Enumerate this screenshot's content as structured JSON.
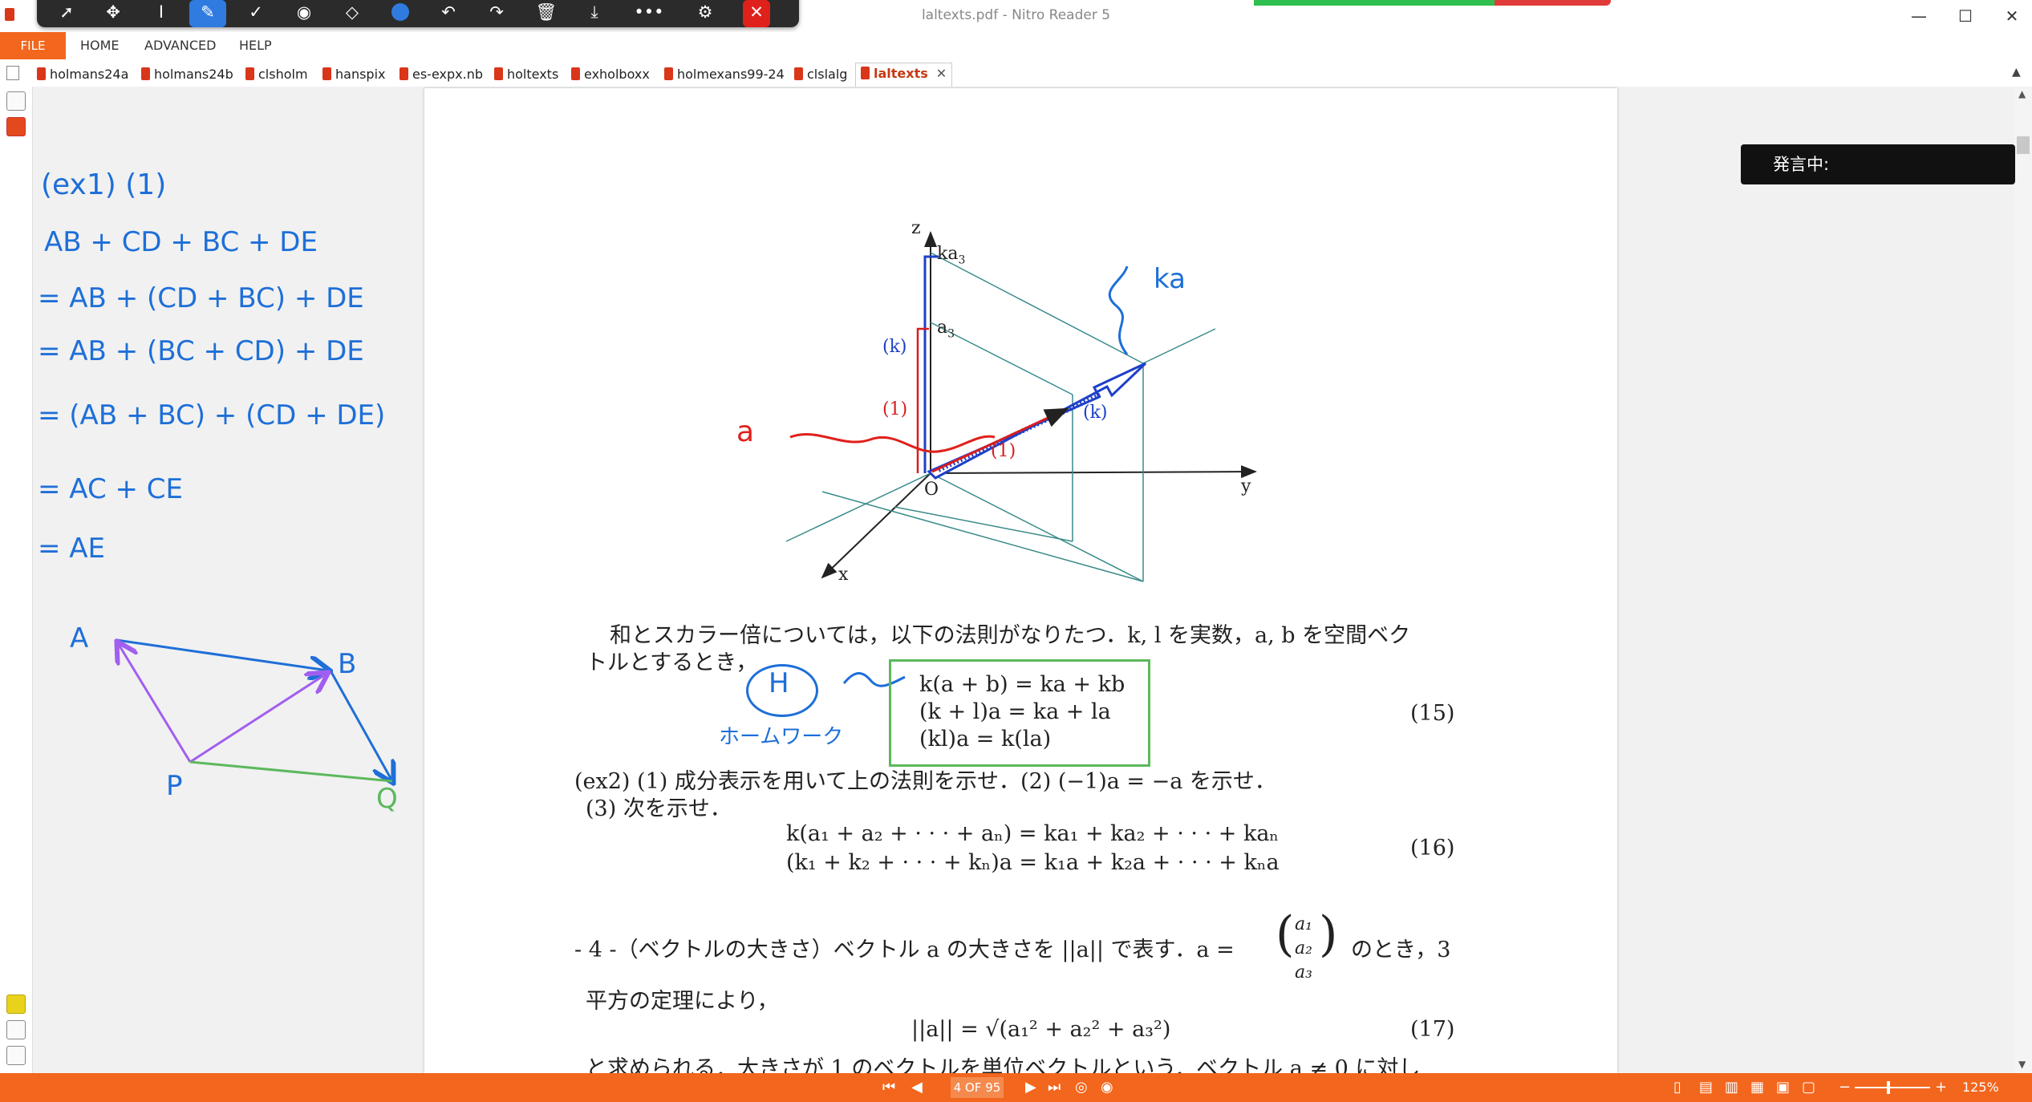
{
  "window": {
    "title": "laltexts.pdf - Nitro Reader 5",
    "minimize": "—",
    "maximize": "☐",
    "close": "✕"
  },
  "ribbon": {
    "file": "FILE",
    "home": "HOME",
    "advanced": "ADVANCED",
    "help": "HELP"
  },
  "tabs": [
    {
      "label": "holmans24a"
    },
    {
      "label": "holmans24b"
    },
    {
      "label": "clsholm"
    },
    {
      "label": "hanspix"
    },
    {
      "label": "es-expx.nb"
    },
    {
      "label": "holtexts"
    },
    {
      "label": "exholboxx"
    },
    {
      "label": "holmexans99-24"
    },
    {
      "label": "clslalg"
    },
    {
      "label": "laltexts"
    }
  ],
  "speaking_overlay": "発言中:",
  "status": {
    "page": "4 OF 95",
    "zoom": "125%"
  },
  "figure": {
    "z": "z",
    "y": "y",
    "x": "x",
    "origin": "O",
    "ka3": "ka",
    "ka3_sub": "3",
    "a3": "a",
    "a3_sub": "3",
    "k_left": "(k)",
    "one_left": "(1)",
    "k_arrow": "(k)",
    "one_arrow": "(1)"
  },
  "document": {
    "para1_line1": "和とスカラー倍については，以下の法則がなりたつ．k, l を実数，a, b を空間ベク",
    "para1_line2": "トルとするとき，",
    "eq15": [
      "k(a + b) = ka + kb",
      "(k + l)a = ka + la",
      "(kl)a = k(la)"
    ],
    "eq15_num": "(15)",
    "ex2_line1": "(ex2) (1) 成分表示を用いて上の法則を示せ．(2) (−1)a = −a を示せ．",
    "ex2_line2": "(3) 次を示せ．",
    "eq16": [
      "k(a₁ + a₂ + · · · + aₙ) = ka₁ + ka₂ + · · · + kaₙ",
      "(k₁ + k₂ + · · · + kₙ)a = k₁a + k₂a + · · · + kₙa"
    ],
    "eq16_num": "(16)",
    "sec4_pre": "- 4 -（ベクトルの大きさ）ベクトル a の大きさを ||a|| で表す．a =",
    "sec4_post": "のとき，3",
    "vec_comp": [
      "a₁",
      "a₂",
      "a₃"
    ],
    "sec4_line2": "平方の定理により，",
    "eq17": "||a|| = √(a₁² + a₂² + a₃²)",
    "eq17_num": "(17)",
    "last_line": "と求められる．大きさが 1 のベクトルを単位ベクトルという．ベクトル a ≠ 0 に対し"
  },
  "handwriting": {
    "left_lines": [
      "(ex1) (1)",
      "AB + CD + BC + DE",
      "= AB + (CD + BC) + DE",
      "= AB + (BC + CD) + DE",
      "= (AB + BC) + (CD + DE)",
      "= AC  +  CE",
      "=  AE"
    ],
    "triangle": {
      "a": "A",
      "b": "B",
      "p": "P",
      "q": "Q"
    },
    "ka": "ka",
    "a": "a",
    "h": "H",
    "homework": "ホームワーク"
  },
  "colors": {
    "accent": "#f2661d",
    "pen_blue": "#1e6fd8",
    "pen_red": "#e0201a",
    "pen_purple": "#a25ef0",
    "pen_green": "#5cb85c",
    "figure_teal": "#3a8a8a",
    "toolbar_active": "#2f7be0"
  }
}
